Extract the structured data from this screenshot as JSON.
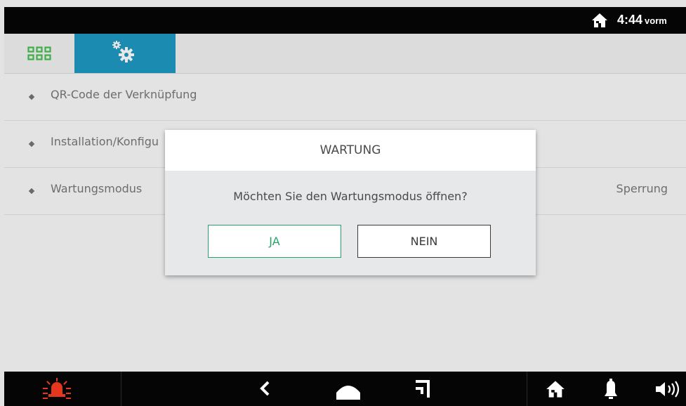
{
  "status_bar": {
    "time": "4:44",
    "suffix": "vorm",
    "icons": [
      "home-icon"
    ]
  },
  "tabs": [
    {
      "name": "apps",
      "icon": "grid-icon",
      "active": false
    },
    {
      "name": "settings",
      "icon": "settings-gears-icon",
      "active": true
    }
  ],
  "menu": {
    "items": [
      {
        "label": "QR-Code der Verknüpfung",
        "value": ""
      },
      {
        "label": "Installation/Konfigu",
        "value": ""
      },
      {
        "label": "Wartungsmodus",
        "value": "Sperrung"
      }
    ]
  },
  "dialog": {
    "title": "WARTUNG",
    "message": "Möchten Sie den Wartungsmodus öffnen?",
    "yes_label": "JA",
    "no_label": "NEIN"
  },
  "bottom_bar": {
    "icons": [
      "alarm-siren-icon",
      "back-icon",
      "home-nav-icon",
      "recent-icon",
      "home-icon",
      "bell-icon",
      "speaker-icon"
    ]
  },
  "colors": {
    "accent": "#1b8bb1",
    "confirm": "#27a26a",
    "alarm": "#e5371f",
    "grid_icon": "#3fae49"
  }
}
